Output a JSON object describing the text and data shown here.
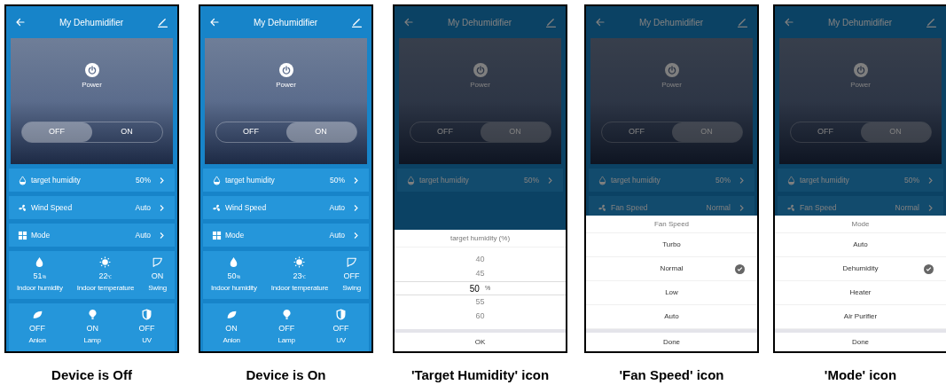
{
  "screens": [
    {
      "title": "My Dehumidifier",
      "power_label": "Power",
      "power_toggle": [
        {
          "label": "OFF",
          "selected": true
        },
        {
          "label": "ON",
          "selected": false
        }
      ],
      "settings": [
        {
          "kind": "humidity",
          "label": "target humidity",
          "value": "50%"
        },
        {
          "kind": "wind",
          "label": "Wind Speed",
          "value": "Auto"
        },
        {
          "kind": "mode",
          "label": "Mode",
          "value": "Auto"
        }
      ],
      "sensors": [
        {
          "kind": "humidity",
          "value": "51",
          "unit": "%",
          "label": "Indoor humidity"
        },
        {
          "kind": "temperature",
          "value": "22",
          "unit": "℃",
          "label": "Indoor temperature"
        },
        {
          "kind": "swing",
          "value": "ON",
          "label": "Swing"
        }
      ],
      "switches": [
        {
          "kind": "anion",
          "value": "OFF",
          "label": "Anion"
        },
        {
          "kind": "lamp",
          "value": "ON",
          "label": "Lamp"
        },
        {
          "kind": "uv",
          "value": "OFF",
          "label": "UV"
        }
      ],
      "caption": "Device is Off"
    },
    {
      "title": "My Dehumidifier",
      "power_label": "Power",
      "power_toggle": [
        {
          "label": "OFF",
          "selected": false
        },
        {
          "label": "ON",
          "selected": true
        }
      ],
      "settings": [
        {
          "kind": "humidity",
          "label": "target humidity",
          "value": "50%"
        },
        {
          "kind": "wind",
          "label": "Wind Speed",
          "value": "Auto"
        },
        {
          "kind": "mode",
          "label": "Mode",
          "value": "Auto"
        }
      ],
      "sensors": [
        {
          "kind": "humidity",
          "value": "50",
          "unit": "%",
          "label": "Indoor humidity"
        },
        {
          "kind": "temperature",
          "value": "23",
          "unit": "℃",
          "label": "Indoor temperature"
        },
        {
          "kind": "swing",
          "value": "OFF",
          "label": "Swing"
        }
      ],
      "switches": [
        {
          "kind": "anion",
          "value": "ON",
          "label": "Anion"
        },
        {
          "kind": "lamp",
          "value": "OFF",
          "label": "Lamp"
        },
        {
          "kind": "uv",
          "value": "OFF",
          "label": "UV"
        }
      ],
      "caption": "Device is On"
    },
    {
      "title": "My Dehumidifier",
      "power_label": "Power",
      "power_toggle": [
        {
          "label": "OFF",
          "selected": false
        },
        {
          "label": "ON",
          "selected": true
        }
      ],
      "settings": [
        {
          "kind": "humidity",
          "label": "target humidity",
          "value": "50%"
        }
      ],
      "sheet": {
        "kind": "picker",
        "title": "target humidity (%)",
        "unit": "%",
        "options": [
          {
            "label": "40",
            "selected": false
          },
          {
            "label": "45",
            "selected": false
          },
          {
            "label": "50",
            "selected": true
          },
          {
            "label": "55",
            "selected": false
          },
          {
            "label": "60",
            "selected": false
          }
        ],
        "button": "OK"
      },
      "caption": "'Target Humidity' icon"
    },
    {
      "title": "My Dehumidifier",
      "power_label": "Power",
      "power_toggle": [
        {
          "label": "OFF",
          "selected": false
        },
        {
          "label": "ON",
          "selected": true
        }
      ],
      "settings": [
        {
          "kind": "humidity",
          "label": "target humidity",
          "value": "50%"
        },
        {
          "kind": "wind",
          "label": "Fan Speed",
          "value": "Normal"
        }
      ],
      "sheet": {
        "kind": "list",
        "title": "Fan Speed",
        "options": [
          {
            "label": "Turbo",
            "selected": false
          },
          {
            "label": "Normal",
            "selected": true
          },
          {
            "label": "Low",
            "selected": false
          },
          {
            "label": "Auto",
            "selected": false
          }
        ],
        "button": "Done"
      },
      "caption": "'Fan Speed' icon"
    },
    {
      "title": "My Dehumidifier",
      "power_label": "Power",
      "power_toggle": [
        {
          "label": "OFF",
          "selected": false
        },
        {
          "label": "ON",
          "selected": true
        }
      ],
      "settings": [
        {
          "kind": "humidity",
          "label": "target humidity",
          "value": "50%"
        },
        {
          "kind": "wind",
          "label": "Fan Speed",
          "value": "Normal"
        }
      ],
      "sheet": {
        "kind": "list",
        "title": "Mode",
        "options": [
          {
            "label": "Auto",
            "selected": false
          },
          {
            "label": "Dehumidity",
            "selected": true
          },
          {
            "label": "Heater",
            "selected": false
          },
          {
            "label": "Air Purifier",
            "selected": false
          }
        ],
        "button": "Done"
      },
      "caption": "'Mode' icon"
    }
  ]
}
